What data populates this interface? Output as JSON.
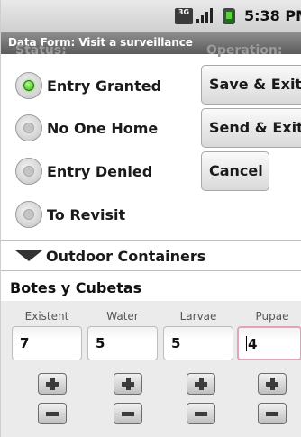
{
  "status_bar": {
    "time": "5:38 PM",
    "network_icon_label": "3G",
    "icons": [
      "3g-icon",
      "signal-icon",
      "battery-icon"
    ]
  },
  "title_bar": {
    "title": "Data Form: Visit a surveillance"
  },
  "form": {
    "status_heading": "Status:",
    "operation_heading": "Operation:",
    "status_options": [
      {
        "label": "Entry Granted",
        "checked": true
      },
      {
        "label": "No One Home",
        "checked": false
      },
      {
        "label": "Entry Denied",
        "checked": false
      },
      {
        "label": "To Revisit",
        "checked": false
      }
    ],
    "buttons": {
      "save_exit": "Save & Exit",
      "send_exit": "Send & Exit",
      "cancel": "Cancel"
    },
    "section": {
      "title": "Outdoor Containers",
      "expanded": true
    },
    "subsection": {
      "title": "Botes y Cubetas"
    },
    "columns": [
      {
        "label": "Existent",
        "value": "7"
      },
      {
        "label": "Water",
        "value": "5"
      },
      {
        "label": "Larvae",
        "value": "5"
      },
      {
        "label": "Pupae",
        "value": "4"
      }
    ]
  },
  "colors": {
    "radio_checked": "#2fae10",
    "title_bar": "#6b6b6b",
    "focused_border": "#e0a6b8"
  }
}
